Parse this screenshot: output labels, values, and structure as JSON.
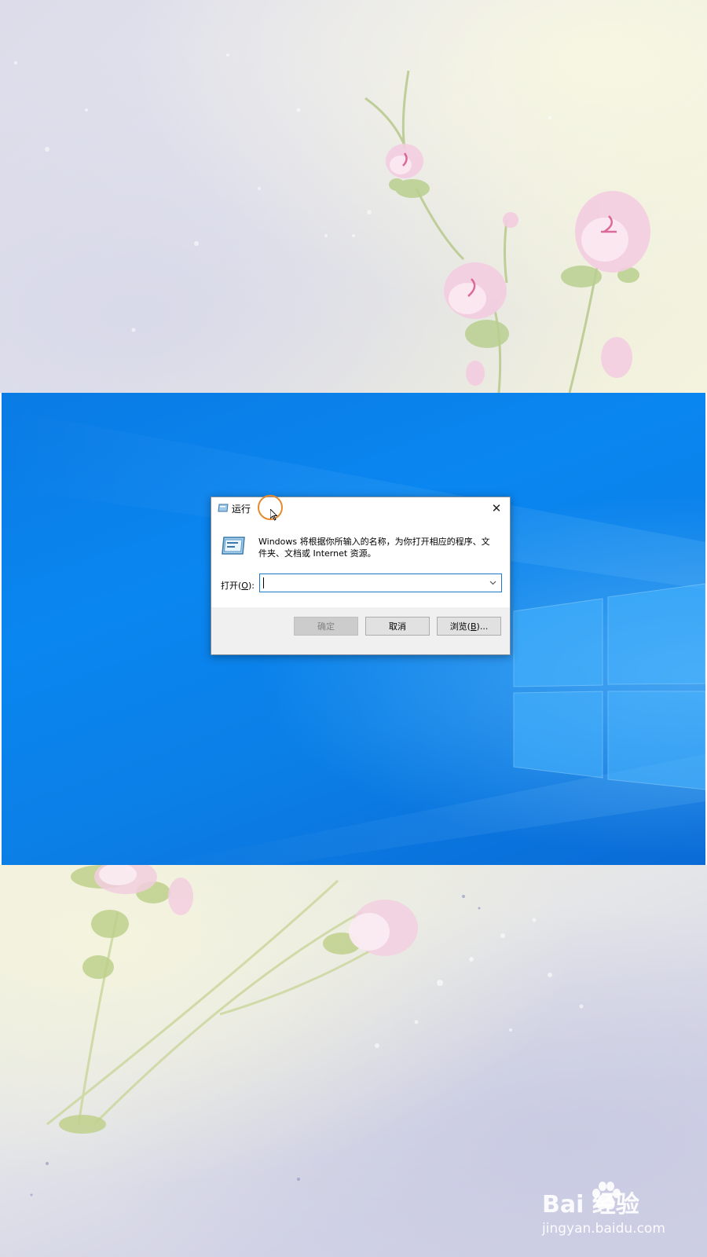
{
  "dialog": {
    "title": "运行",
    "description": "Windows 将根据你所输入的名称，为你打开相应的程序、文件夹、文档或 Internet 资源。",
    "open_label_prefix": "打开(",
    "open_label_key": "O",
    "open_label_suffix": "):",
    "open_value": "",
    "buttons": {
      "ok": "确定",
      "cancel": "取消",
      "browse_prefix": "浏览(",
      "browse_key": "B",
      "browse_suffix": ")..."
    },
    "close_glyph": "✕"
  },
  "watermark": {
    "brand": "Bai 经验",
    "url": "jingyan.baidu.com",
    "icon": "baidu-paw-icon"
  },
  "colors": {
    "desktop_blue": "#0a86f0",
    "accent_border": "#1e78c8",
    "highlight": "#e8892c"
  },
  "icons": {
    "title": "run-icon",
    "close": "close-icon",
    "dropdown": "chevron-down-icon",
    "cursor": "mouse-pointer-icon"
  }
}
